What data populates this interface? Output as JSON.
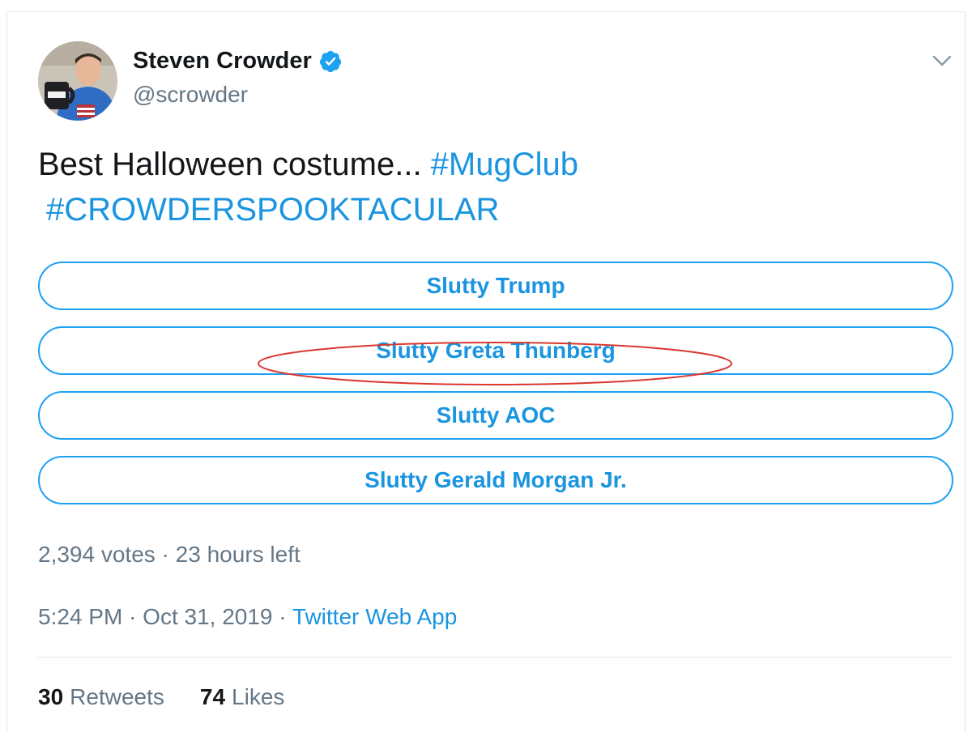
{
  "tweet": {
    "author": {
      "display_name": "Steven Crowder",
      "handle": "@scrowder",
      "verified": true
    },
    "text": "Best Halloween costume... ",
    "hashtags": [
      "#MugClub",
      "#CROWDERSPOOKTACULAR"
    ],
    "poll": {
      "options": [
        {
          "label": "Slutty Trump"
        },
        {
          "label": "Slutty Greta Thunberg",
          "highlighted": true
        },
        {
          "label": "Slutty AOC"
        },
        {
          "label": "Slutty Gerald Morgan Jr."
        }
      ],
      "votes": "2,394 votes",
      "separator": " · ",
      "time_left": "23 hours left"
    },
    "time": "5:24 PM",
    "date": "Oct 31, 2019",
    "source": "Twitter Web App",
    "stats": {
      "retweets_count": "30",
      "retweets_label": "Retweets",
      "likes_count": "74",
      "likes_label": "Likes"
    }
  },
  "colors": {
    "link": "#1b95e0",
    "border": "#1da1f2",
    "text": "#14171a",
    "muted": "#657786",
    "highlight_ring": "#d9382e"
  },
  "icons": {
    "verified": "verified-badge-icon",
    "menu": "chevron-down-icon"
  }
}
